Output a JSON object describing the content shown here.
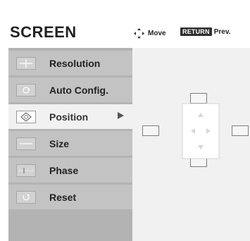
{
  "header": {
    "title": "SCREEN",
    "move_label": "Move",
    "return_key_label": "RETURN",
    "prev_label": "Prev."
  },
  "menu": {
    "items": [
      {
        "label": "Resolution",
        "icon": "resolution-icon"
      },
      {
        "label": "Auto Config.",
        "icon": "auto-config-icon"
      },
      {
        "label": "Position",
        "icon": "position-icon",
        "selected": true
      },
      {
        "label": "Size",
        "icon": "size-icon"
      },
      {
        "label": "Phase",
        "icon": "phase-icon"
      },
      {
        "label": "Reset",
        "icon": "reset-icon"
      }
    ]
  },
  "position_control": {
    "directions": [
      "up",
      "down",
      "left",
      "right"
    ]
  },
  "colors": {
    "menu_background": "#b3b3b3",
    "item_background": "#c3c3c3",
    "selected_item_background": "#f1f1f1",
    "text": "#222222",
    "return_key_background": "#2f2f2f"
  }
}
